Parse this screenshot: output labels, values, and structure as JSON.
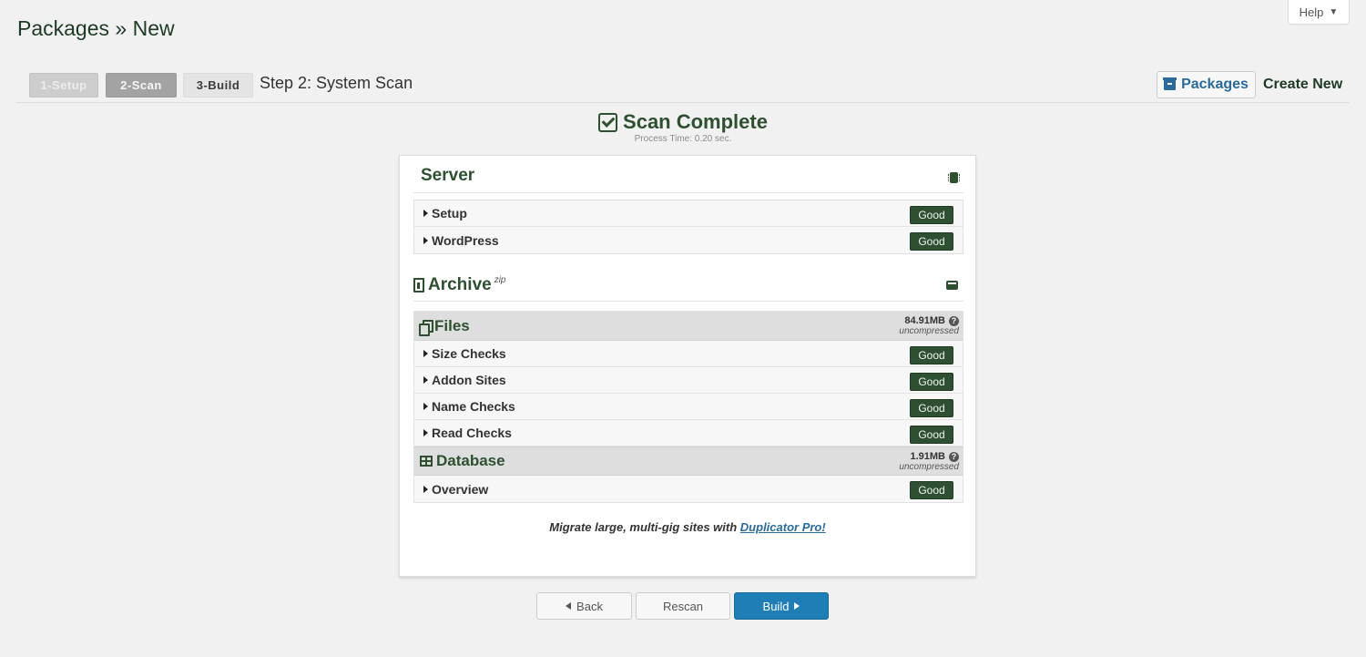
{
  "page": {
    "title": "Packages » New"
  },
  "help": {
    "label": "Help",
    "caret": "▼"
  },
  "steps": [
    {
      "label": "1-Setup",
      "state": "done"
    },
    {
      "label": "2-Scan",
      "state": "active"
    },
    {
      "label": "3-Build",
      "state": "pending"
    }
  ],
  "step_caption": "Step 2: System Scan",
  "toolbar": {
    "packages_label": "Packages",
    "create_new_label": "Create New"
  },
  "scan": {
    "title": "Scan Complete",
    "process_time": "Process Time: 0.20 sec."
  },
  "server": {
    "title": "Server",
    "rows": [
      {
        "label": "Setup",
        "status": "Good"
      },
      {
        "label": "WordPress",
        "status": "Good"
      }
    ]
  },
  "archive": {
    "title": "Archive",
    "format": "zip",
    "files": {
      "title": "Files",
      "size": "84.91MB",
      "note": "uncompressed",
      "rows": [
        {
          "label": "Size Checks",
          "status": "Good"
        },
        {
          "label": "Addon Sites",
          "status": "Good"
        },
        {
          "label": "Name Checks",
          "status": "Good"
        },
        {
          "label": "Read Checks",
          "status": "Good"
        }
      ]
    },
    "database": {
      "title": "Database",
      "size": "1.91MB",
      "note": "uncompressed",
      "rows": [
        {
          "label": "Overview",
          "status": "Good"
        }
      ]
    }
  },
  "promo": {
    "text": "Migrate large, multi-gig sites with",
    "link": "Duplicator Pro!"
  },
  "buttons": {
    "back": "Back",
    "rescan": "Rescan",
    "build": "Build"
  },
  "colors": {
    "accent_green": "#2e5031",
    "badge_green": "#2f4f33",
    "primary_blue": "#1f7eb5",
    "link_blue": "#2a6b9a"
  },
  "icons": {
    "help_caret": "triangle-down",
    "packages": "archive-box",
    "scan_complete": "checkbox-checked",
    "server": "memory-chip",
    "archive": "zip-file",
    "archive_toggle": "hard-drive",
    "files": "copy-files",
    "database": "table-grid",
    "row_expander": "triangle-right",
    "size_help": "question-circle",
    "back": "triangle-left",
    "build": "triangle-right"
  }
}
